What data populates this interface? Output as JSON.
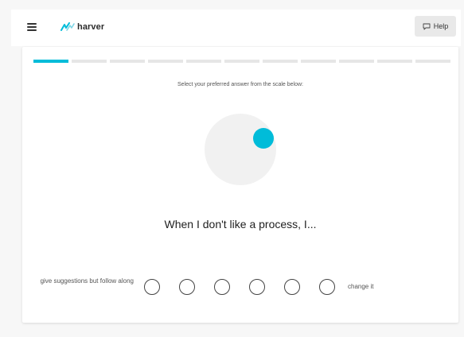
{
  "header": {
    "brand": "harver",
    "help_label": "Help"
  },
  "progress": {
    "total_steps": 11,
    "current_step": 1
  },
  "question": {
    "instruction": "Select your preferred answer from the scale below:",
    "prompt": "When I don't like a process, I...",
    "scale_left": "give suggestions but follow along",
    "scale_right": "change it",
    "option_count": 6
  },
  "colors": {
    "accent": "#00bcd9",
    "background": "#f7f7f7",
    "card": "#ffffff"
  },
  "icons": {
    "menu": "hamburger-menu-icon",
    "help": "chat-bubble-icon",
    "logo": "harver-logo-icon"
  }
}
